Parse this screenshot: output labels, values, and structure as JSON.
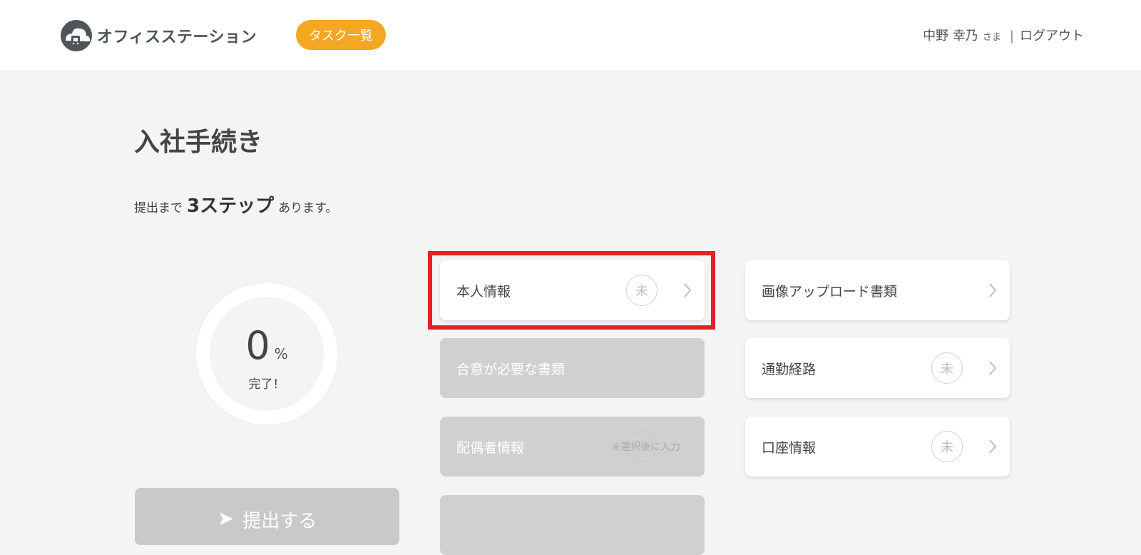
{
  "header": {
    "logo_text": "オフィスステーション",
    "task_list_label": "タスク一覧",
    "user_name": "中野 幸乃",
    "honorific": "さま",
    "separator": "|",
    "logout_label": "ログアウト"
  },
  "main": {
    "title": "入社手続き",
    "steps_prefix": "提出まで",
    "steps_count": "3ステップ",
    "steps_suffix": "あります。"
  },
  "progress": {
    "percent": "0",
    "unit": "%",
    "caption": "完了！"
  },
  "submit": {
    "label": "提出する"
  },
  "cards_left": [
    {
      "label": "本人情報",
      "badge": "未",
      "state": "active"
    },
    {
      "label": "合意が必要な書類",
      "state": "disabled"
    },
    {
      "label": "配偶者情報",
      "note": "※選択後に入力",
      "state": "disabled"
    }
  ],
  "cards_right": [
    {
      "label": "画像アップロード書類",
      "state": "active"
    },
    {
      "label": "通勤経路",
      "badge": "未",
      "state": "active"
    },
    {
      "label": "口座情報",
      "badge": "未",
      "state": "active"
    }
  ],
  "colors": {
    "accent": "#f5a623",
    "highlight": "#e32025",
    "disabled_card": "#d0d0d0"
  }
}
